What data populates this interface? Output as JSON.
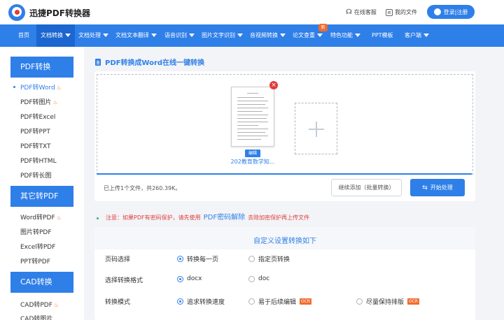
{
  "header": {
    "brand": "迅捷PDF转换器",
    "online_service": "在线客服",
    "my_files": "我的文件",
    "login": "登录|注册"
  },
  "nav": {
    "items": [
      {
        "label": "首页"
      },
      {
        "label": "文档转换"
      },
      {
        "label": "文档处理"
      },
      {
        "label": "文档文本翻译"
      },
      {
        "label": "语音识别"
      },
      {
        "label": "图片文字识别"
      },
      {
        "label": "音视频转换"
      },
      {
        "label": "论文查重"
      },
      {
        "label": "特色功能"
      },
      {
        "label": "PPT模板"
      },
      {
        "label": "客户端"
      }
    ],
    "new_badge": "新"
  },
  "sidebar": {
    "sections": [
      {
        "title": "PDF转换",
        "items": [
          "PDF转Word",
          "PDF转图片",
          "PDF转Excel",
          "PDF转PPT",
          "PDF转TXT",
          "PDF转HTML",
          "PDF转长图"
        ]
      },
      {
        "title": "其它转PDF",
        "items": [
          "Word转PDF",
          "图片转PDF",
          "Excel转PDF",
          "PPT转PDF"
        ]
      },
      {
        "title": "CAD转换",
        "items": [
          "CAD转PDF",
          "CAD转图片"
        ]
      }
    ]
  },
  "main": {
    "title": "PDF转换成Word在线一键转换",
    "edit_tag": "编辑",
    "file_name": "202教育数学知...",
    "upload_status": "已上传1个文件，共260.39K。",
    "continue_button": "继续添加（批量转换）",
    "start_button": "开始处理",
    "notice_prefix": "注意：如果PDF有密码保护，请先使用",
    "notice_link": "PDF密码解除",
    "notice_suffix": "去除加密保护再上传文件"
  },
  "settings": {
    "title": "自定义设置转换如下",
    "rows": [
      {
        "label": "页码选择",
        "options": [
          "转换每一页",
          "指定页转换"
        ]
      },
      {
        "label": "选择转换格式",
        "options": [
          "docx",
          "doc"
        ]
      },
      {
        "label": "转换模式",
        "options": [
          "追求转换速度",
          "易于后续编辑",
          "尽量保持排版"
        ]
      }
    ],
    "ocr_tag": "OCR"
  },
  "colors": {
    "primary": "#2f7fe8",
    "accent": "#f26b2e",
    "danger": "#e23b3b"
  },
  "icons": {
    "fire": "fire-icon",
    "close": "close-icon",
    "plus": "plus-icon"
  }
}
